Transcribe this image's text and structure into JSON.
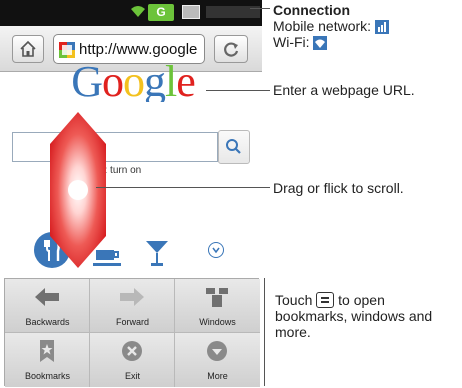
{
  "browser": {
    "url": "http://www.google",
    "logo_text": "Google",
    "page_note": "I        eta) is off: turn on"
  },
  "menu": {
    "items": [
      {
        "label": "Backwards",
        "icon": "arrow-left-icon"
      },
      {
        "label": "Forward",
        "icon": "arrow-right-icon"
      },
      {
        "label": "Windows",
        "icon": "windows-icon"
      },
      {
        "label": "Bookmarks",
        "icon": "bookmark-star-icon"
      },
      {
        "label": "Exit",
        "icon": "close-circle-icon"
      },
      {
        "label": "More",
        "icon": "chevron-down-circle-icon"
      }
    ]
  },
  "callouts": {
    "connection": {
      "title": "Connection",
      "mobile": "Mobile network:",
      "wifi": "Wi-Fi:"
    },
    "url": "Enter a webpage URL.",
    "scroll": "Drag or flick to scroll.",
    "menu": {
      "line1_prefix": "Touch",
      "line1_suffix": "to open",
      "line2": "bookmarks, windows and",
      "line3": "more."
    }
  },
  "colors": {
    "accent_blue": "#3a76b8",
    "scroll_red": "#e0221f",
    "status_green": "#6cc33a"
  }
}
